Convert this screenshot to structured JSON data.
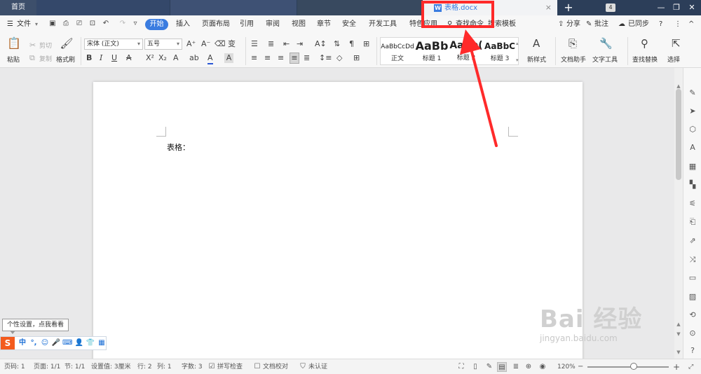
{
  "tabs": {
    "home": "首页",
    "active_doc": "表格.docx",
    "close": "×",
    "add": "+",
    "window_count": "4"
  },
  "window_controls": {
    "minimize": "—",
    "restore": "❐",
    "close": "✕"
  },
  "menu": {
    "file": "文件",
    "items": [
      "开始",
      "插入",
      "页面布局",
      "引用",
      "审阅",
      "视图",
      "章节",
      "安全",
      "开发工具",
      "特色应用",
      "查找命令",
      "搜索模板"
    ],
    "right": {
      "share": "分享",
      "comment": "批注",
      "sync": "已同步",
      "help": "?",
      "more": "⋮",
      "collapse": "^"
    }
  },
  "ribbon": {
    "paste": "粘贴",
    "cut": "剪切",
    "copy": "复制",
    "format_painter": "格式刷",
    "font_name": "宋体 (正文)",
    "font_size": "五号",
    "styles": [
      {
        "sample": "AaBbCcDd",
        "name": "正文"
      },
      {
        "sample": "AaBb",
        "name": "标题 1"
      },
      {
        "sample": "AaBb(",
        "name": "标题 2"
      },
      {
        "sample": "AaBbC",
        "name": "标题 3"
      }
    ],
    "new_style": "新样式",
    "doc_assistant": "文档助手",
    "text_tools": "文字工具",
    "find_replace": "查找替换",
    "select": "选择"
  },
  "document": {
    "body_text": "表格："
  },
  "ime": {
    "tip": "个性设置，点我看看",
    "logo": "S",
    "lang": "中"
  },
  "watermark": {
    "main": "Bai 经验",
    "sub": "jingyan.baidu.com"
  },
  "status": {
    "page_num": "页码: 1",
    "pages": "页面: 1/1",
    "section": "节: 1/1",
    "setting": "设置值: 3厘米",
    "row": "行: 2",
    "col": "列: 1",
    "words": "字数: 3",
    "spell": "拼写检查",
    "proof": "文档校对",
    "cert": "未认证",
    "zoom": "120%"
  },
  "colors": {
    "accent": "#3a7ce0",
    "tabbar": "#2c3e59",
    "annotation": "#ff2a2a"
  }
}
